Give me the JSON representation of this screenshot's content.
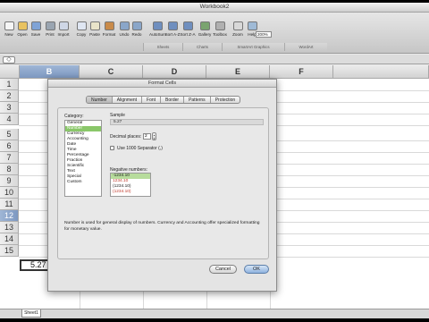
{
  "window": {
    "title": "Workbook2"
  },
  "toolbar": {
    "items": [
      {
        "label": "New",
        "icon": "new-icon"
      },
      {
        "label": "Open",
        "icon": "open-icon"
      },
      {
        "label": "Save",
        "icon": "save-icon"
      },
      {
        "label": "Print",
        "icon": "print-icon"
      },
      {
        "label": "Import",
        "icon": "import-icon"
      },
      {
        "label": "Copy",
        "icon": "copy-icon"
      },
      {
        "label": "Paste",
        "icon": "paste-icon"
      },
      {
        "label": "Format",
        "icon": "format-icon"
      },
      {
        "label": "Undo",
        "icon": "undo-icon"
      },
      {
        "label": "Redo",
        "icon": "redo-icon"
      },
      {
        "label": "AutoSum",
        "icon": "autosum-icon"
      },
      {
        "label": "Sort A-Z",
        "icon": "sort-az-icon"
      },
      {
        "label": "Sort Z-A",
        "icon": "sort-za-icon"
      },
      {
        "label": "Gallery",
        "icon": "gallery-icon"
      },
      {
        "label": "Toolbox",
        "icon": "toolbox-icon"
      },
      {
        "label": "Zoom",
        "icon": "zoom-icon"
      },
      {
        "label": "Help",
        "icon": "help-icon"
      }
    ],
    "zoom_value": "200%",
    "groups": [
      "Sheets",
      "Charts",
      "SmartArt Graphics",
      "WordArt"
    ]
  },
  "formula_bar": {
    "name_box": "◇"
  },
  "grid": {
    "columns": [
      "B",
      "C",
      "D",
      "E",
      "F"
    ],
    "selected_column": "B",
    "rows": [
      "1",
      "2",
      "3",
      "4",
      "5",
      "6",
      "7",
      "8",
      "9",
      "10",
      "11",
      "12",
      "13",
      "14",
      "15"
    ],
    "selected_row": "12",
    "active_cell_value": "5.27"
  },
  "sheet_tabs": [
    "Sheet1"
  ],
  "dialog": {
    "title": "Format Cells",
    "tabs": [
      "Number",
      "Alignment",
      "Font",
      "Border",
      "Patterns",
      "Protection"
    ],
    "active_tab": "Number",
    "category_label": "Category:",
    "categories": [
      "General",
      "Number",
      "Currency",
      "Accounting",
      "Date",
      "Time",
      "Percentage",
      "Fraction",
      "Scientific",
      "Text",
      "Special",
      "Custom"
    ],
    "selected_category": "Number",
    "sample_label": "Sample",
    "sample_value": "5.27",
    "decimal_label": "Decimal places:",
    "decimal_value": "2",
    "separator_label": "Use 1000 Separator (,)",
    "separator_checked": false,
    "negative_label": "Negative numbers:",
    "negative_options": [
      {
        "text": "-1234.10",
        "color": "#222222"
      },
      {
        "text": "1234.10",
        "color": "#c0392b"
      },
      {
        "text": "(1234.10)",
        "color": "#222222"
      },
      {
        "text": "(1234.10)",
        "color": "#c0392b"
      }
    ],
    "selected_negative": 0,
    "description": "Number is used for general display of numbers.  Currency and Accounting offer specialized formatting for monetary value.",
    "cancel_label": "Cancel",
    "ok_label": "OK"
  }
}
